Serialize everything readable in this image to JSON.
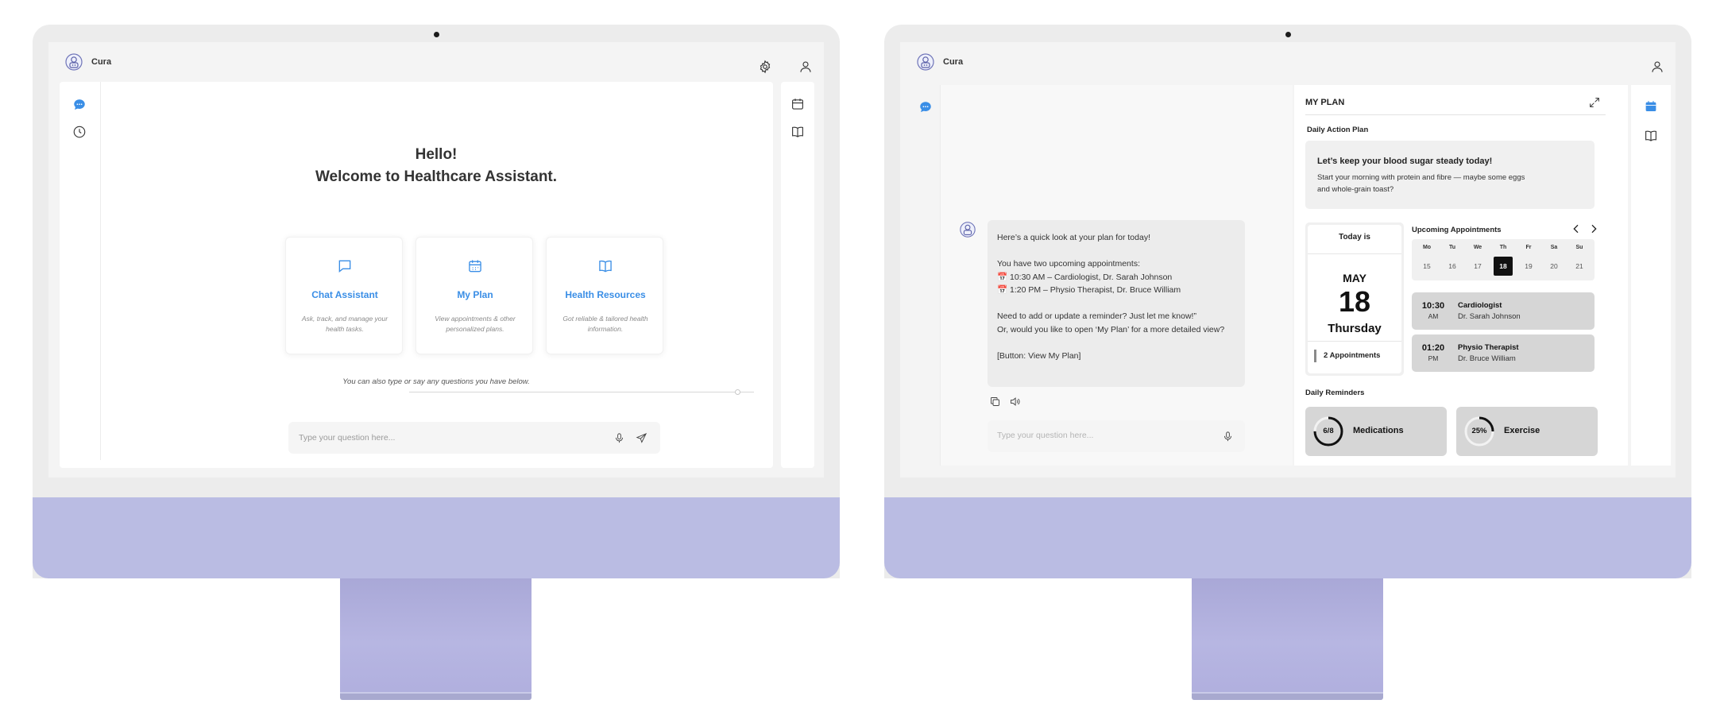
{
  "app": {
    "name": "Cura"
  },
  "left": {
    "greeting": "Hello!",
    "welcome": "Welcome to Healthcare Assistant.",
    "cards": [
      {
        "title": "Chat Assistant",
        "desc": "Ask, track, and manage your health tasks.",
        "icon": "chat-icon"
      },
      {
        "title": "My Plan",
        "desc": "View appointments & other personalized plans.",
        "icon": "calendar-icon"
      },
      {
        "title": "Health Resources",
        "desc": "Got reliable & tailored health information.",
        "icon": "book-icon"
      }
    ],
    "hint": "You can also type or say any questions you have below.",
    "input_placeholder": "Type your question here..."
  },
  "right": {
    "message": "Here’s a quick look at your plan for today!\n\nYou have two upcoming appointments:\n📅 10:30 AM – Cardiologist, Dr. Sarah Johnson\n📅 1:20 PM – Physio Therapist, Dr. Bruce William\n\nNeed to add or update a reminder? Just let me know!”\nOr, would you like to open ‘My Plan’ for a more detailed view?\n\n[Button: View My Plan]",
    "input_placeholder": "Type your question here...",
    "plan": {
      "title": "MY PLAN",
      "daily_action_label": "Daily Action Plan",
      "action_heading": "Let’s keep your blood sugar steady today!",
      "action_body": "Start your morning with protein and fibre — maybe some eggs and whole-grain toast?",
      "today": {
        "label": "Today is",
        "month": "MAY",
        "day": "18",
        "weekday": "Thursday",
        "appointments": "2 Appointments"
      },
      "upcoming_label": "Upcoming Appointments",
      "week": {
        "days": [
          "Mo",
          "Tu",
          "We",
          "Th",
          "Fr",
          "Sa",
          "Su"
        ],
        "dates": [
          "15",
          "16",
          "17",
          "18",
          "19",
          "20",
          "21"
        ],
        "selected_index": 3
      },
      "appointments": [
        {
          "time": "10:30",
          "ampm": "AM",
          "type": "Cardiologist",
          "doctor": "Dr. Sarah Johnson"
        },
        {
          "time": "01:20",
          "ampm": "PM",
          "type": "Physio Therapist",
          "doctor": "Dr. Bruce William"
        }
      ],
      "reminders_label": "Daily Reminders",
      "reminders": [
        {
          "value": "6/8",
          "label": "Medications",
          "progress": 0.75
        },
        {
          "value": "25%",
          "label": "Exercise",
          "progress": 0.25
        }
      ]
    }
  },
  "colors": {
    "accent": "#3a8ee6",
    "chin": "#babce3",
    "selected_day": "#111111"
  }
}
